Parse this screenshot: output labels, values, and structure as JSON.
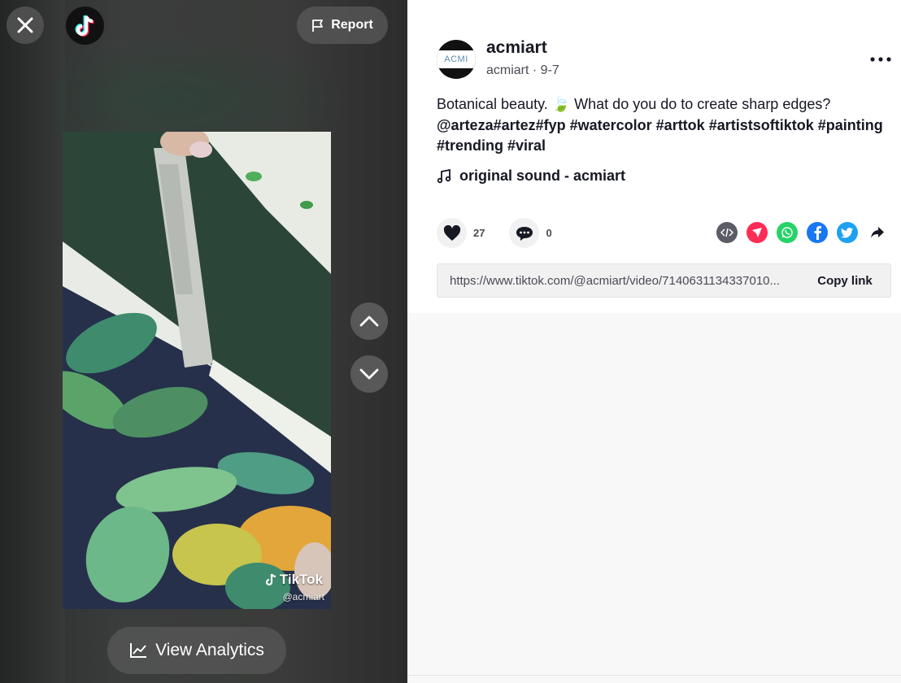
{
  "header": {
    "report_label": "Report"
  },
  "video": {
    "watermark_brand": "TikTok",
    "watermark_handle": "@acmiart"
  },
  "analytics": {
    "label": "View Analytics"
  },
  "author": {
    "username": "acmiart",
    "meta": "acmiart · 9-7",
    "avatar_text": "ACMI"
  },
  "post": {
    "caption_text": "Botanical beauty. 🍃 What do you do to create sharp edges?",
    "caption_tags": "@arteza#artez#fyp #watercolor #arttok #artistsoftiktok #painting #trending #viral",
    "sound": "original sound - acmiart"
  },
  "stats": {
    "likes": "27",
    "comments": "0"
  },
  "share": {
    "link": "https://www.tiktok.com/@acmiart/video/7140631134337010...",
    "copy_label": "Copy link",
    "icons": [
      "embed-icon",
      "send-icon",
      "whatsapp-icon",
      "facebook-icon",
      "twitter-icon",
      "share-arrow-icon"
    ],
    "colors": {
      "embed": "#5c5c66",
      "send": "#fe2c55",
      "whatsapp": "#25d366",
      "facebook": "#1877f2",
      "twitter": "#1da1f2"
    }
  }
}
